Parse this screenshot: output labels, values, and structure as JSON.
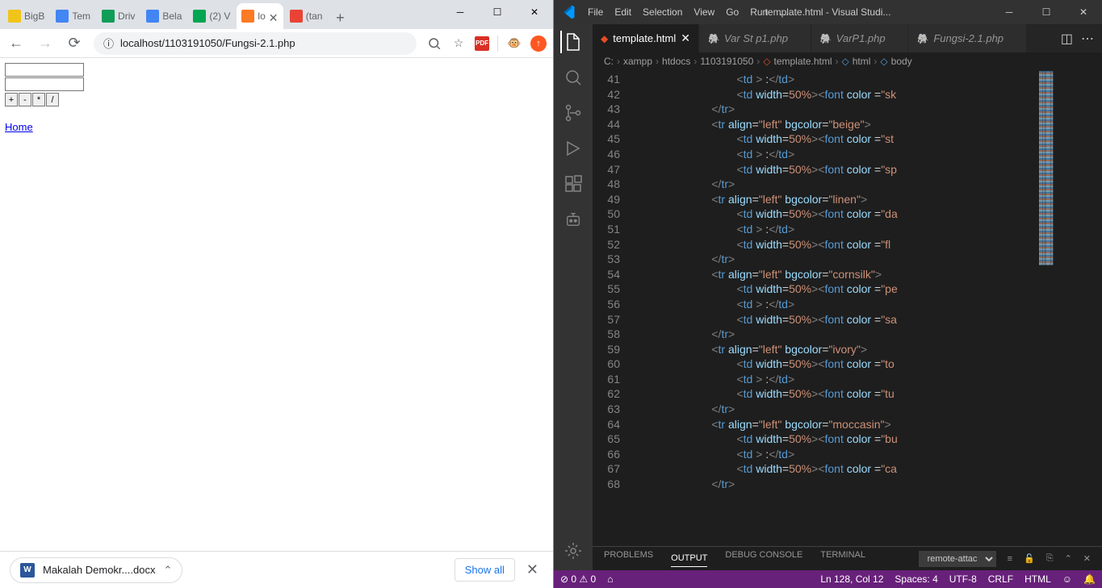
{
  "chrome": {
    "tabs": [
      {
        "label": "BigB",
        "icon": "#f0c419"
      },
      {
        "label": "Tem",
        "icon": "#4285f4"
      },
      {
        "label": "Driv",
        "icon": "#0f9d58"
      },
      {
        "label": "Bela",
        "icon": "#4285f4"
      },
      {
        "label": "(2) V",
        "icon": "#00a651"
      },
      {
        "label": "lo",
        "icon": "#fb7a24",
        "active": true
      },
      {
        "label": "(tan",
        "icon": "#ea4335"
      }
    ],
    "address": "localhost/1103191050/Fungsi-2.1.php",
    "page": {
      "buttons": [
        "+",
        "-",
        "*",
        "/"
      ],
      "home": "Home"
    },
    "download": {
      "file": "Makalah Demokr....docx",
      "showall": "Show all"
    }
  },
  "vscode": {
    "menu": [
      "File",
      "Edit",
      "Selection",
      "View",
      "Go",
      "Run",
      "…"
    ],
    "title": "template.html - Visual Studi...",
    "tabs": [
      {
        "label": "template.html",
        "icon": "html",
        "active": true
      },
      {
        "label": "Var St p1.php",
        "icon": "php"
      },
      {
        "label": "VarP1.php",
        "icon": "php"
      },
      {
        "label": "Fungsi-2.1.php",
        "icon": "php"
      }
    ],
    "breadcrumb": [
      "C:",
      "xampp",
      "htdocs",
      "1103191050",
      "template.html",
      "html",
      "body"
    ],
    "lines": [
      41,
      42,
      43,
      44,
      45,
      46,
      47,
      48,
      49,
      50,
      51,
      52,
      53,
      54,
      55,
      56,
      57,
      58,
      59,
      60,
      61,
      62,
      63,
      64,
      65,
      66,
      67,
      68
    ],
    "code": [
      {
        "indent": 8,
        "type": "td-simple"
      },
      {
        "indent": 8,
        "type": "td-font",
        "color": "sk"
      },
      {
        "indent": 6,
        "type": "tr-close"
      },
      {
        "indent": 6,
        "type": "tr-open",
        "bg": "beige"
      },
      {
        "indent": 8,
        "type": "td-font",
        "color": "st"
      },
      {
        "indent": 8,
        "type": "td-simple"
      },
      {
        "indent": 8,
        "type": "td-font",
        "color": "sp"
      },
      {
        "indent": 6,
        "type": "tr-close"
      },
      {
        "indent": 6,
        "type": "tr-open",
        "bg": "linen"
      },
      {
        "indent": 8,
        "type": "td-font",
        "color": "da"
      },
      {
        "indent": 8,
        "type": "td-simple"
      },
      {
        "indent": 8,
        "type": "td-font",
        "color": "fl"
      },
      {
        "indent": 6,
        "type": "tr-close"
      },
      {
        "indent": 6,
        "type": "tr-open",
        "bg": "cornsilk"
      },
      {
        "indent": 8,
        "type": "td-font",
        "color": "pe"
      },
      {
        "indent": 8,
        "type": "td-simple"
      },
      {
        "indent": 8,
        "type": "td-font",
        "color": "sa"
      },
      {
        "indent": 6,
        "type": "tr-close"
      },
      {
        "indent": 6,
        "type": "tr-open",
        "bg": "ivory"
      },
      {
        "indent": 8,
        "type": "td-font",
        "color": "to"
      },
      {
        "indent": 8,
        "type": "td-simple"
      },
      {
        "indent": 8,
        "type": "td-font",
        "color": "tu"
      },
      {
        "indent": 6,
        "type": "tr-close"
      },
      {
        "indent": 6,
        "type": "tr-open",
        "bg": "moccasin"
      },
      {
        "indent": 8,
        "type": "td-font",
        "color": "bu"
      },
      {
        "indent": 8,
        "type": "td-simple"
      },
      {
        "indent": 8,
        "type": "td-font",
        "color": "ca"
      },
      {
        "indent": 6,
        "type": "tr-close"
      }
    ],
    "panel": {
      "tabs": [
        "PROBLEMS",
        "OUTPUT",
        "DEBUG CONSOLE",
        "TERMINAL"
      ],
      "active": 1,
      "select": "remote-attac"
    },
    "status": {
      "errors": "0",
      "warnings": "0",
      "ln": "Ln 128, Col 12",
      "spaces": "Spaces: 4",
      "enc": "UTF-8",
      "eol": "CRLF",
      "lang": "HTML"
    }
  }
}
